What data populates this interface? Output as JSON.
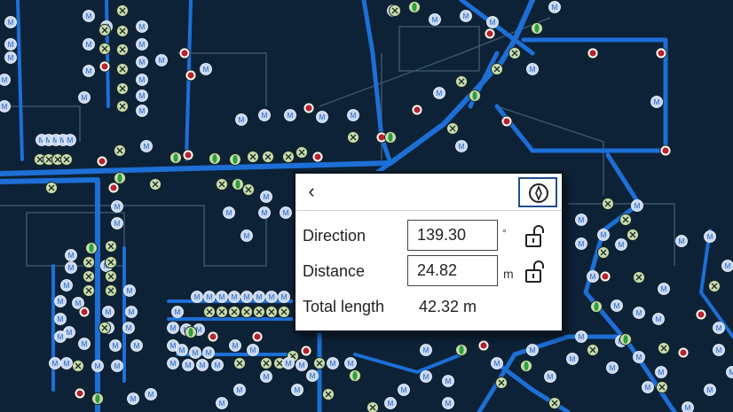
{
  "map": {
    "marker_label": "M",
    "colors": {
      "background": "#0d2236",
      "road_outline": "#3a5468",
      "pipe": "#1d6fd6",
      "node_m": "#c8d8f4",
      "node_x": "#c9dcb0",
      "node_valve": "#2f9e40",
      "node_red": "#b3242f"
    },
    "icons": [
      "meter-icon",
      "junction-icon",
      "valve-icon",
      "hydrant-icon"
    ]
  },
  "panel": {
    "back_icon": "chevron-left-icon",
    "compass_icon": "compass-icon",
    "direction": {
      "label": "Direction",
      "value": "139.30",
      "unit": "°"
    },
    "distance": {
      "label": "Distance",
      "value": "24.82",
      "unit": "m"
    },
    "total": {
      "label": "Total length",
      "value": "42.32 m"
    },
    "lock_icon": "unlock-icon"
  }
}
